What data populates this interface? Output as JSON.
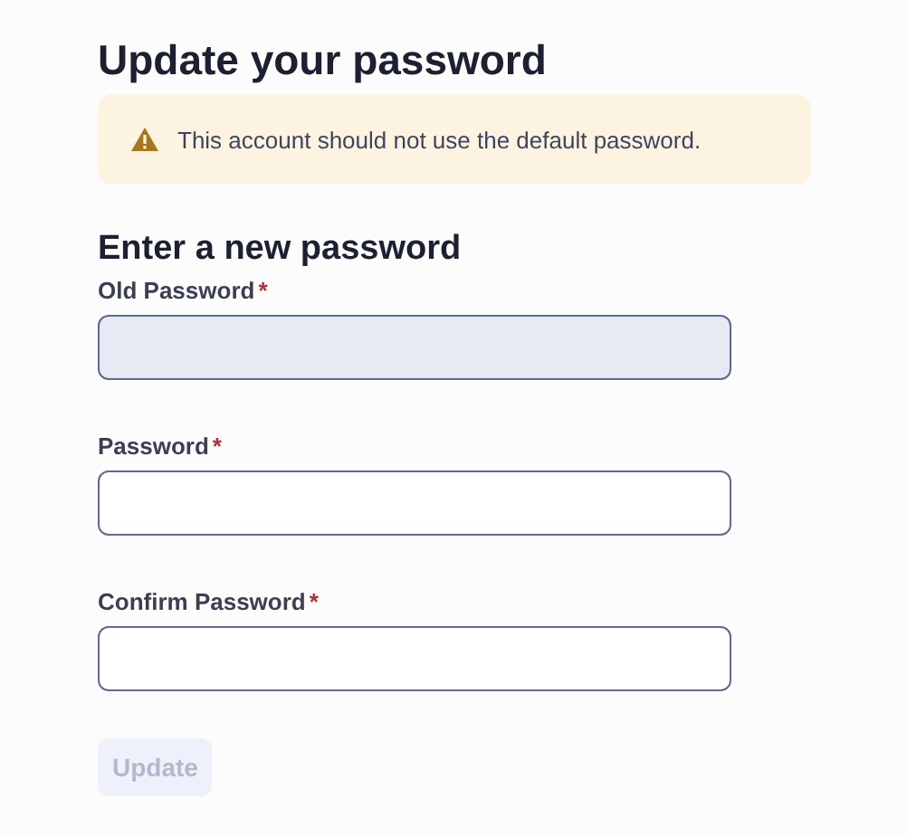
{
  "title": "Update your password",
  "alert": {
    "kind": "warning",
    "text": "This account should not use the default password."
  },
  "section_title": "Enter a new password",
  "fields": [
    {
      "label": "Old Password",
      "required_mark": "*",
      "highlighted": true
    },
    {
      "label": "Password",
      "required_mark": "*",
      "highlighted": false
    },
    {
      "label": "Confirm Password",
      "required_mark": "*",
      "highlighted": false
    }
  ],
  "submit": {
    "label": "Update",
    "disabled": true
  }
}
